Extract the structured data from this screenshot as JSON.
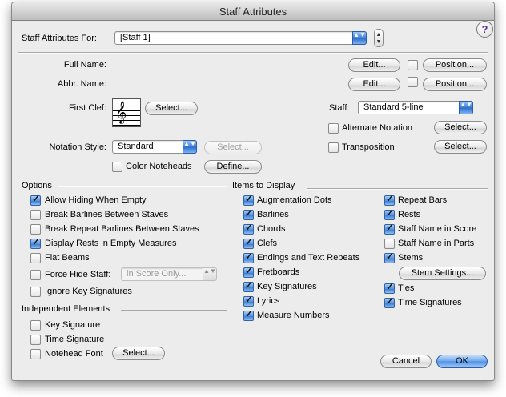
{
  "window": {
    "title": "Staff Attributes"
  },
  "staff_for": {
    "label": "Staff Attributes For:",
    "value": "[Staff 1]"
  },
  "help": {
    "icon": "?"
  },
  "full_name": {
    "label": "Full Name:",
    "edit": "Edit...",
    "position": "Position..."
  },
  "abbr_name": {
    "label": "Abbr. Name:",
    "edit": "Edit...",
    "position": "Position..."
  },
  "first_clef": {
    "label": "First Clef:",
    "select": "Select...",
    "glyph": "𝄞"
  },
  "staff": {
    "label": "Staff:",
    "value": "Standard 5-line",
    "alternate_notation": "Alternate Notation",
    "alt_select": "Select...",
    "transposition": "Transposition",
    "trans_select": "Select..."
  },
  "notation_style": {
    "label": "Notation Style:",
    "value": "Standard",
    "select": "Select...",
    "color_noteheads": "Color Noteheads",
    "define": "Define..."
  },
  "options": {
    "heading": "Options",
    "items": [
      {
        "label": "Allow Hiding When Empty",
        "checked": true
      },
      {
        "label": "Break Barlines Between Staves",
        "checked": false
      },
      {
        "label": "Break Repeat Barlines Between Staves",
        "checked": false
      },
      {
        "label": "Display Rests in Empty Measures",
        "checked": true
      },
      {
        "label": "Flat Beams",
        "checked": false
      },
      {
        "label": "Force Hide Staff:",
        "checked": false
      },
      {
        "label": "Ignore Key Signatures",
        "checked": false
      }
    ],
    "force_hide_value": "in Score Only..."
  },
  "independent": {
    "heading": "Independent Elements",
    "items": [
      {
        "label": "Key Signature",
        "checked": false
      },
      {
        "label": "Time Signature",
        "checked": false
      },
      {
        "label": "Notehead Font",
        "checked": false
      }
    ],
    "notehead_select": "Select..."
  },
  "items_display": {
    "heading": "Items to Display",
    "col1": [
      {
        "label": "Augmentation Dots",
        "checked": true
      },
      {
        "label": "Barlines",
        "checked": true
      },
      {
        "label": "Chords",
        "checked": true
      },
      {
        "label": "Clefs",
        "checked": true
      },
      {
        "label": "Endings and Text Repeats",
        "checked": true
      },
      {
        "label": "Fretboards",
        "checked": true
      },
      {
        "label": "Key Signatures",
        "checked": true
      },
      {
        "label": "Lyrics",
        "checked": true
      },
      {
        "label": "Measure Numbers",
        "checked": true
      }
    ],
    "col2": [
      {
        "label": "Repeat Bars",
        "checked": true
      },
      {
        "label": "Rests",
        "checked": true
      },
      {
        "label": "Staff Name in Score",
        "checked": true
      },
      {
        "label": "Staff Name in Parts",
        "checked": false
      },
      {
        "label": "Stems",
        "checked": true
      }
    ],
    "stem_settings": "Stem Settings...",
    "col2b": [
      {
        "label": "Ties",
        "checked": true
      },
      {
        "label": "Time Signatures",
        "checked": true
      }
    ]
  },
  "buttons": {
    "cancel": "Cancel",
    "ok": "OK"
  },
  "glyphs": {
    "check": "✓",
    "popup_arrows": "▲▼",
    "stepper_up": "▲",
    "stepper_down": "▼"
  }
}
